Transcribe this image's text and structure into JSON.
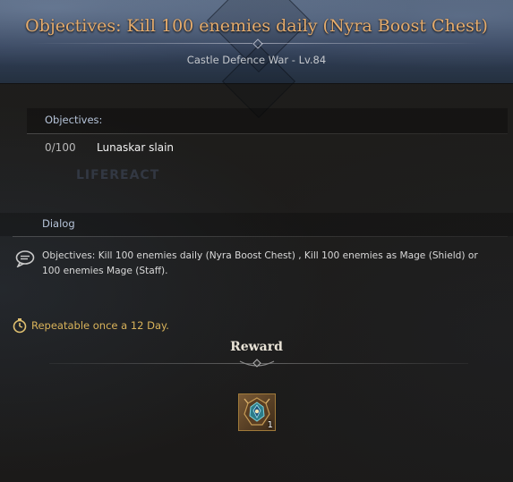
{
  "header": {
    "title": "Objectives: Kill 100 enemies daily (Nyra Boost Chest)",
    "subtitle": "Castle Defence War - Lv.84"
  },
  "objectives": {
    "label": "Objectives:",
    "items": [
      {
        "progress": "0/100",
        "text": "Lunaskar slain"
      }
    ]
  },
  "watermark": "LIFEREACT",
  "dialog": {
    "label": "Dialog",
    "text": "Objectives: Kill 100 enemies daily (Nyra Boost Chest) , Kill 100 enemies as Mage (Shield)  or 100 enemies Mage (Staff)."
  },
  "repeat": {
    "text": "Repeatable once a 12 Day.",
    "color": "#d9b35a"
  },
  "reward": {
    "title": "Reward",
    "items": [
      {
        "icon": "boost-chest-icon",
        "count": "1"
      }
    ]
  },
  "colors": {
    "title": "#e6ac6c",
    "section_label": "#b6c4d9",
    "header_bg": "#33415a"
  }
}
